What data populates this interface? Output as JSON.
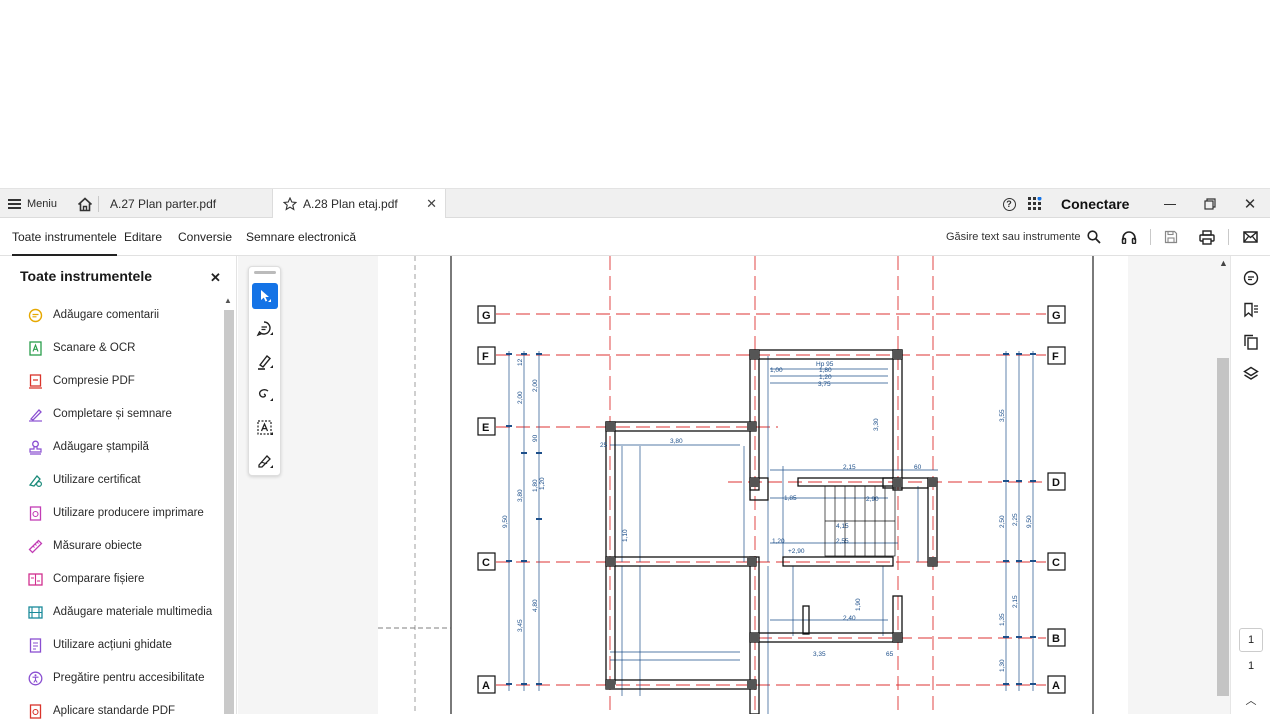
{
  "titlebar": {
    "menu_label": "Meniu",
    "tabs": [
      {
        "label": "A.27 Plan parter.pdf"
      },
      {
        "label": "A.28 Plan etaj.pdf"
      }
    ],
    "connect_label": "Conectare"
  },
  "toolbar": {
    "tabs": [
      {
        "label": "Toate instrumentele",
        "active": true
      },
      {
        "label": "Editare"
      },
      {
        "label": "Conversie"
      },
      {
        "label": "Semnare electronică"
      }
    ],
    "find_label": "Găsire text sau instrumente"
  },
  "left_panel": {
    "title": "Toate instrumentele",
    "items": [
      {
        "label": "Adăugare comentarii",
        "icon": "comment-icon",
        "color": "#e6a800"
      },
      {
        "label": "Scanare & OCR",
        "icon": "scan-ocr-icon",
        "color": "#2a9d4b"
      },
      {
        "label": "Compresie PDF",
        "icon": "compress-pdf-icon",
        "color": "#d9342b"
      },
      {
        "label": "Completare și semnare",
        "icon": "fill-sign-icon",
        "color": "#8a4fd1"
      },
      {
        "label": "Adăugare ștampilă",
        "icon": "stamp-icon",
        "color": "#8a4fd1"
      },
      {
        "label": "Utilizare certificat",
        "icon": "certificate-icon",
        "color": "#1a8a7a"
      },
      {
        "label": "Utilizare producere imprimare",
        "icon": "print-production-icon",
        "color": "#c23db5"
      },
      {
        "label": "Măsurare obiecte",
        "icon": "measure-icon",
        "color": "#c23db5"
      },
      {
        "label": "Comparare fișiere",
        "icon": "compare-icon",
        "color": "#d12f8f"
      },
      {
        "label": "Adăugare materiale multimedia",
        "icon": "multimedia-icon",
        "color": "#1a8a9a"
      },
      {
        "label": "Utilizare acțiuni ghidate",
        "icon": "guided-actions-icon",
        "color": "#8a4fd1"
      },
      {
        "label": "Pregătire pentru accesibilitate",
        "icon": "accessibility-icon",
        "color": "#8a4fd1"
      },
      {
        "label": "Aplicare standarde PDF",
        "icon": "pdf-standards-icon",
        "color": "#d9342b"
      }
    ]
  },
  "drawing": {
    "axis_labels": [
      "G",
      "F",
      "E",
      "D",
      "C",
      "B",
      "A"
    ],
    "dimensions": [
      "12",
      "2,00",
      "2,00",
      "90",
      "1,80",
      "1,20",
      "3,80",
      "9,50",
      "1,10",
      "3,45",
      "4,80",
      "3,80",
      "1,00",
      "1,80",
      "1,20",
      "Hp 95",
      "3,75",
      "3,30",
      "2,15",
      "2,90",
      "4,15",
      "2,55",
      "3,35",
      "3,55",
      "2,50",
      "2,25",
      "9,50",
      "2,15",
      "1,35",
      "1,30",
      "+2,90",
      "1,85",
      "1,20",
      "2,40",
      "1,90",
      "25",
      "60",
      "65"
    ]
  },
  "page_nav": {
    "current": "1",
    "total": "1"
  }
}
